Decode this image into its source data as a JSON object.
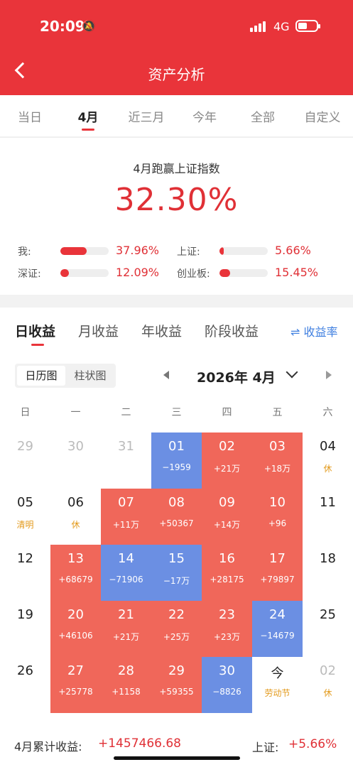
{
  "status": {
    "time": "20:09",
    "network": "4G"
  },
  "nav": {
    "title": "资产分析"
  },
  "period_tabs": [
    "当日",
    "4月",
    "近三月",
    "今年",
    "全部",
    "自定义"
  ],
  "summary": {
    "beat_label": "4月跑赢上证指数",
    "beat_pct": "32.30%",
    "compare": [
      {
        "label": "我:",
        "value": "37.96%",
        "pct": 37.96
      },
      {
        "label": "上证:",
        "value": "5.66%",
        "pct": 5.66
      },
      {
        "label": "深证:",
        "value": "12.09%",
        "pct": 12.09
      },
      {
        "label": "创业板:",
        "value": "15.45%",
        "pct": 15.45
      }
    ]
  },
  "return_tabs": [
    "日收益",
    "月收益",
    "年收益",
    "阶段收益"
  ],
  "rate_toggle": "⇌ 收益率",
  "view_toggle": {
    "calendar": "日历图",
    "bar": "柱状图"
  },
  "month_label": "2026年 4月",
  "weekdays": [
    "日",
    "一",
    "二",
    "三",
    "四",
    "五",
    "六"
  ],
  "calendar": [
    [
      {
        "d": "29",
        "t": "gray"
      },
      {
        "d": "30",
        "t": "gray"
      },
      {
        "d": "31",
        "t": "gray"
      },
      {
        "d": "01",
        "a": "−1959",
        "t": "neg"
      },
      {
        "d": "02",
        "a": "+21万",
        "t": "pos"
      },
      {
        "d": "03",
        "a": "+18万",
        "t": "pos"
      },
      {
        "d": "04",
        "a": "休",
        "t": "hol"
      }
    ],
    [
      {
        "d": "05",
        "a": "清明",
        "t": "hol"
      },
      {
        "d": "06",
        "a": "休",
        "t": "hol"
      },
      {
        "d": "07",
        "a": "+11万",
        "t": "pos"
      },
      {
        "d": "08",
        "a": "+50367",
        "t": "pos"
      },
      {
        "d": "09",
        "a": "+14万",
        "t": "pos"
      },
      {
        "d": "10",
        "a": "+96",
        "t": "pos"
      },
      {
        "d": "11",
        "t": "plain"
      }
    ],
    [
      {
        "d": "12",
        "t": "plain"
      },
      {
        "d": "13",
        "a": "+68679",
        "t": "pos"
      },
      {
        "d": "14",
        "a": "−71906",
        "t": "neg"
      },
      {
        "d": "15",
        "a": "−17万",
        "t": "neg"
      },
      {
        "d": "16",
        "a": "+28175",
        "t": "pos"
      },
      {
        "d": "17",
        "a": "+79897",
        "t": "pos"
      },
      {
        "d": "18",
        "t": "plain"
      }
    ],
    [
      {
        "d": "19",
        "t": "plain"
      },
      {
        "d": "20",
        "a": "+46106",
        "t": "pos"
      },
      {
        "d": "21",
        "a": "+21万",
        "t": "pos"
      },
      {
        "d": "22",
        "a": "+25万",
        "t": "pos"
      },
      {
        "d": "23",
        "a": "+23万",
        "t": "pos"
      },
      {
        "d": "24",
        "a": "−14679",
        "t": "neg"
      },
      {
        "d": "25",
        "t": "plain"
      }
    ],
    [
      {
        "d": "26",
        "t": "plain"
      },
      {
        "d": "27",
        "a": "+25778",
        "t": "pos"
      },
      {
        "d": "28",
        "a": "+1158",
        "t": "pos"
      },
      {
        "d": "29",
        "a": "+59355",
        "t": "pos"
      },
      {
        "d": "30",
        "a": "−8826",
        "t": "neg"
      },
      {
        "d": "今",
        "a": "劳动节",
        "t": "holtoday"
      },
      {
        "d": "02",
        "a": "休",
        "t": "holgray"
      }
    ]
  ],
  "footer": {
    "month_total_label": "4月累计收益:",
    "month_total_value": "+1457466.68",
    "sh_label": "上证:",
    "sh_value": "+5.66%"
  }
}
